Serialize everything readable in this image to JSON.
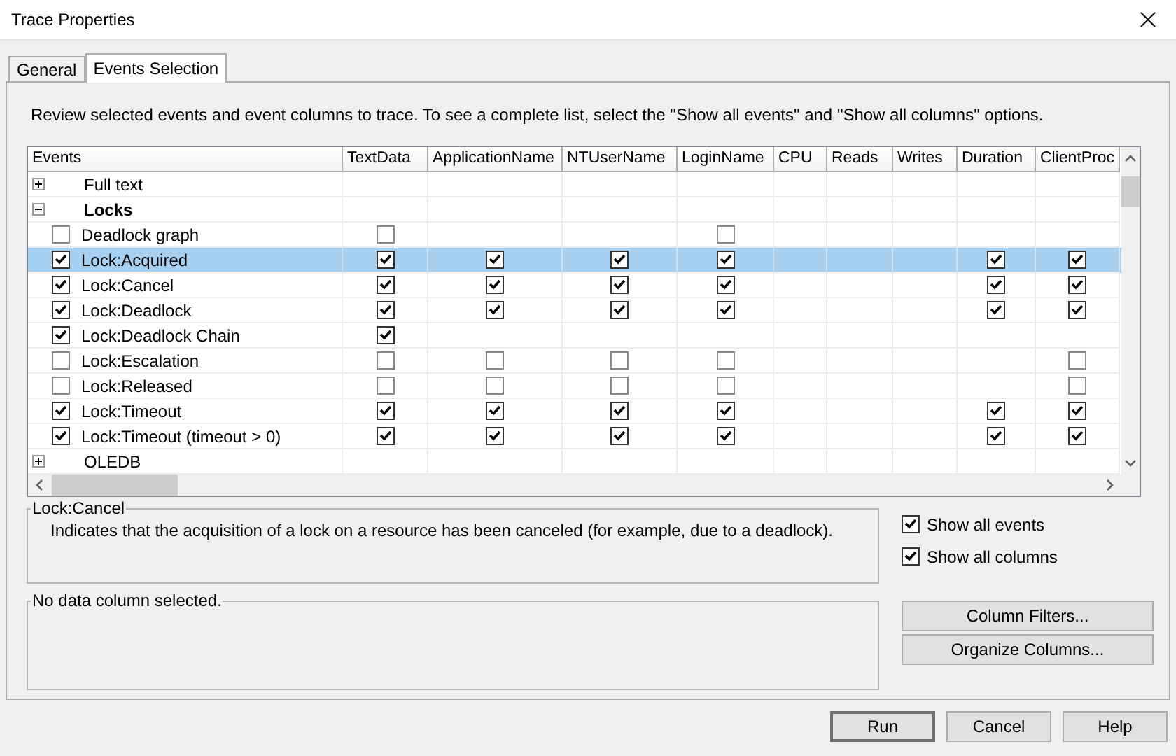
{
  "window": {
    "title": "Trace Properties"
  },
  "tabs": [
    {
      "label": "General",
      "selected": false
    },
    {
      "label": "Events Selection",
      "selected": true
    }
  ],
  "instructions": "Review selected events and event columns to trace. To see a complete list, select the \"Show all events\" and \"Show all columns\" options.",
  "grid": {
    "columns": [
      "Events",
      "TextData",
      "ApplicationName",
      "NTUserName",
      "LoginName",
      "CPU",
      "Reads",
      "Writes",
      "Duration",
      "ClientProc"
    ],
    "rows": [
      {
        "kind": "category",
        "label": "Full text",
        "expanded": false
      },
      {
        "kind": "category",
        "label": "Locks",
        "expanded": true
      },
      {
        "kind": "event",
        "label": "Deadlock graph",
        "checked": false,
        "selected": false,
        "cells": [
          false,
          null,
          null,
          false,
          null,
          null,
          null,
          null,
          null
        ]
      },
      {
        "kind": "event",
        "label": "Lock:Acquired",
        "checked": true,
        "selected": true,
        "cells": [
          true,
          true,
          true,
          true,
          null,
          null,
          null,
          true,
          true
        ]
      },
      {
        "kind": "event",
        "label": "Lock:Cancel",
        "checked": true,
        "selected": false,
        "cells": [
          true,
          true,
          true,
          true,
          null,
          null,
          null,
          true,
          true
        ]
      },
      {
        "kind": "event",
        "label": "Lock:Deadlock",
        "checked": true,
        "selected": false,
        "cells": [
          true,
          true,
          true,
          true,
          null,
          null,
          null,
          true,
          true
        ]
      },
      {
        "kind": "event",
        "label": "Lock:Deadlock Chain",
        "checked": true,
        "selected": false,
        "cells": [
          true,
          null,
          null,
          null,
          null,
          null,
          null,
          null,
          null
        ]
      },
      {
        "kind": "event",
        "label": "Lock:Escalation",
        "checked": false,
        "selected": false,
        "cells": [
          false,
          false,
          false,
          false,
          null,
          null,
          null,
          null,
          false
        ]
      },
      {
        "kind": "event",
        "label": "Lock:Released",
        "checked": false,
        "selected": false,
        "cells": [
          false,
          false,
          false,
          false,
          null,
          null,
          null,
          null,
          false
        ]
      },
      {
        "kind": "event",
        "label": "Lock:Timeout",
        "checked": true,
        "selected": false,
        "cells": [
          true,
          true,
          true,
          true,
          null,
          null,
          null,
          true,
          true
        ]
      },
      {
        "kind": "event",
        "label": "Lock:Timeout (timeout > 0)",
        "checked": true,
        "selected": false,
        "cells": [
          true,
          true,
          true,
          true,
          null,
          null,
          null,
          true,
          true
        ]
      },
      {
        "kind": "category",
        "label": "OLEDB",
        "expanded": false
      }
    ]
  },
  "description": {
    "title": "Lock:Cancel",
    "text": "Indicates that the acquisition of a lock on a resource has been canceled (for example, due to a deadlock)."
  },
  "options": [
    {
      "label": "Show all events",
      "checked": true
    },
    {
      "label": "Show all columns",
      "checked": true
    }
  ],
  "column_info": {
    "title": "No data column selected."
  },
  "side_buttons": [
    "Column Filters...",
    "Organize Columns..."
  ],
  "buttons": [
    {
      "label": "Run",
      "default": true
    },
    {
      "label": "Cancel",
      "default": false
    },
    {
      "label": "Help",
      "default": false
    }
  ]
}
